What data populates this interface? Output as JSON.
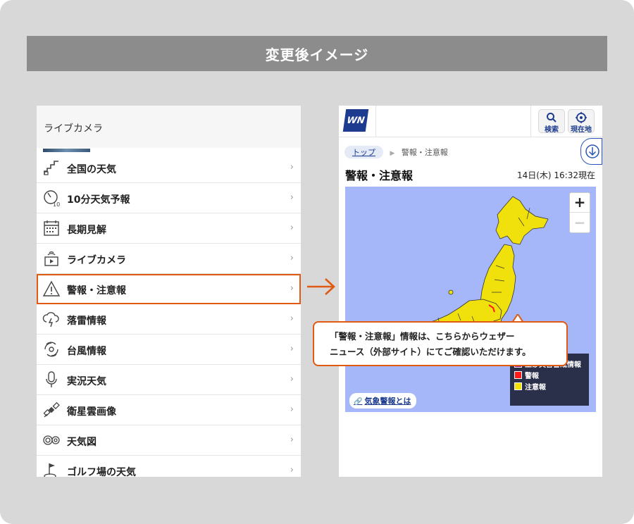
{
  "banner": {
    "title": "変更後イメージ"
  },
  "left_menu": {
    "header": "ライブカメラ",
    "items": [
      {
        "label": "全国の天気",
        "icon": "map-steps-icon",
        "chevron": "›"
      },
      {
        "label": "10分天気予報",
        "icon": "ten-minute-clock-icon",
        "chevron": "›"
      },
      {
        "label": "長期見解",
        "icon": "calendar-icon",
        "chevron": "›"
      },
      {
        "label": "ライブカメラ",
        "icon": "live-camera-icon",
        "chevron": "›"
      },
      {
        "label": "警報・注意報",
        "icon": "warning-triangle-icon",
        "chevron": "›"
      },
      {
        "label": "落雷情報",
        "icon": "lightning-cloud-icon",
        "chevron": "›"
      },
      {
        "label": "台風情報",
        "icon": "typhoon-icon",
        "chevron": "›"
      },
      {
        "label": "実況天気",
        "icon": "microphone-icon",
        "chevron": "›"
      },
      {
        "label": "衛星雲画像",
        "icon": "satellite-icon",
        "chevron": "›"
      },
      {
        "label": "天気図",
        "icon": "weather-chart-icon",
        "chevron": "›"
      },
      {
        "label": "ゴルフ場の天気",
        "icon": "golf-flag-icon",
        "chevron": "›"
      }
    ]
  },
  "right_page": {
    "logo": "WN",
    "search_label": "検索",
    "location_label": "現在地",
    "breadcrumb": {
      "top": "トップ",
      "sep": "▶",
      "current": "警報・注意報"
    },
    "title": "警報・注意報",
    "timestamp": "14日(木) 16:32現在",
    "map": {
      "zoom_in": "+",
      "zoom_out": "−",
      "legend": [
        {
          "label": "土砂災害警戒情報",
          "color": "#9b0fa6"
        },
        {
          "label": "警報",
          "color": "#ff1a1a"
        },
        {
          "label": "注意報",
          "color": "#f5e10a"
        }
      ],
      "link": "気象警報とは",
      "land_color": "#f0e00c",
      "sea_color": "#a6b7f9"
    }
  },
  "callout": {
    "line1": "「警報・注意報」情報は、こちらからウェザー",
    "line2": "ニュース（外部サイト）にてご確認いただけます。"
  },
  "colors": {
    "highlight": "#e05a14",
    "brand": "#1d3c8f"
  }
}
